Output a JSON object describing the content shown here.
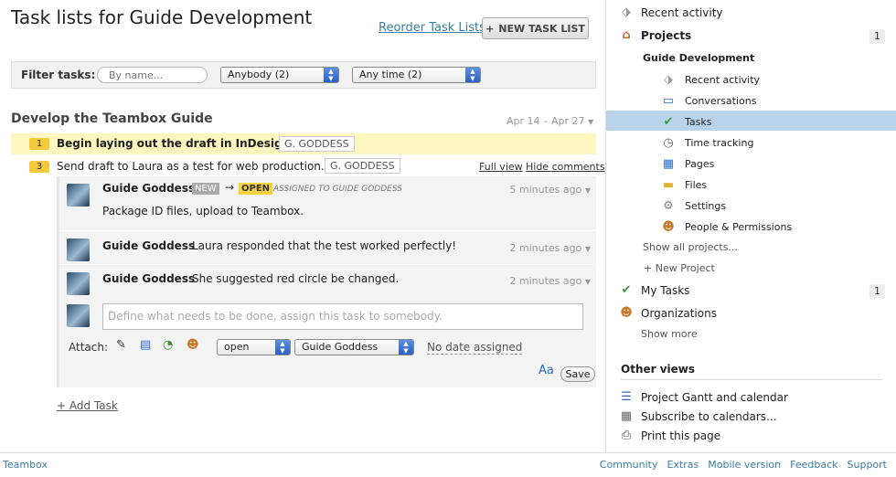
{
  "page": {
    "title": "Task lists for Guide Development",
    "reorder_label": "Reorder Task Lists",
    "new_list_label": "NEW TASK LIST",
    "new_list_icon": "+"
  },
  "filter": {
    "label": "Filter tasks:",
    "search_placeholder": "By name...",
    "who_value": "Anybody (2)",
    "when_value": "Any time (2)"
  },
  "task_list": {
    "title": "Develop the Teambox Guide",
    "dates": "Apr 14 – Apr 27",
    "tasks": [
      {
        "num": "1",
        "name": "Begin laying out the draft in InDesign.",
        "assignee": "G. GODDESS"
      },
      {
        "num": "3",
        "name": "Send draft to Laura as a test for web production.",
        "assignee": "G. GODDESS",
        "full_view": "Full view",
        "hide_comments": "Hide comments"
      }
    ],
    "add_task_label": "+ Add Task"
  },
  "comments": [
    {
      "author": "Guide Goddess",
      "status_from": "NEW",
      "arrow": "→",
      "status_to": "OPEN",
      "assigned": "ASSIGNED TO GUIDE GODDESS",
      "time": "5 minutes ago",
      "text": "Package ID files, upload to Teambox."
    },
    {
      "author": "Guide Goddess",
      "text": "Laura responded that the test worked perfectly!",
      "time": "2 minutes ago"
    },
    {
      "author": "Guide Goddess",
      "text": "She suggested red circle be changed.",
      "time": "2 minutes ago"
    }
  ],
  "new_comment": {
    "placeholder": "Define what needs to be done, assign this task to somebody.",
    "attach_label": "Attach:",
    "status_value": "open",
    "assignee_value": "Guide Goddess",
    "due_label": "No date assigned",
    "save_label": "Save"
  },
  "sidebar": {
    "recent_activity": "Recent activity",
    "projects": "Projects",
    "projects_count": "1",
    "project_name": "Guide Development",
    "project_items": [
      "Recent activity",
      "Conversations",
      "Tasks",
      "Time tracking",
      "Pages",
      "Files",
      "Settings",
      "People & Permissions"
    ],
    "show_all": "Show all projects...",
    "new_project": "+ New Project",
    "my_tasks": "My Tasks",
    "my_tasks_count": "1",
    "organizations": "Organizations",
    "show_more": "Show more",
    "other_views": "Other views",
    "other_items": [
      "Project Gantt and calendar",
      "Subscribe to calendars...",
      "Print this page"
    ]
  },
  "footer": {
    "brand": "Teambox",
    "links": [
      "Community",
      "Extras",
      "Mobile version",
      "Feedback",
      "Support"
    ]
  },
  "colors": {
    "accent": "#3a7fa6",
    "highlight": "#fdf7bf",
    "active": "#b9d3ea",
    "open_tag": "#f7d33b"
  }
}
